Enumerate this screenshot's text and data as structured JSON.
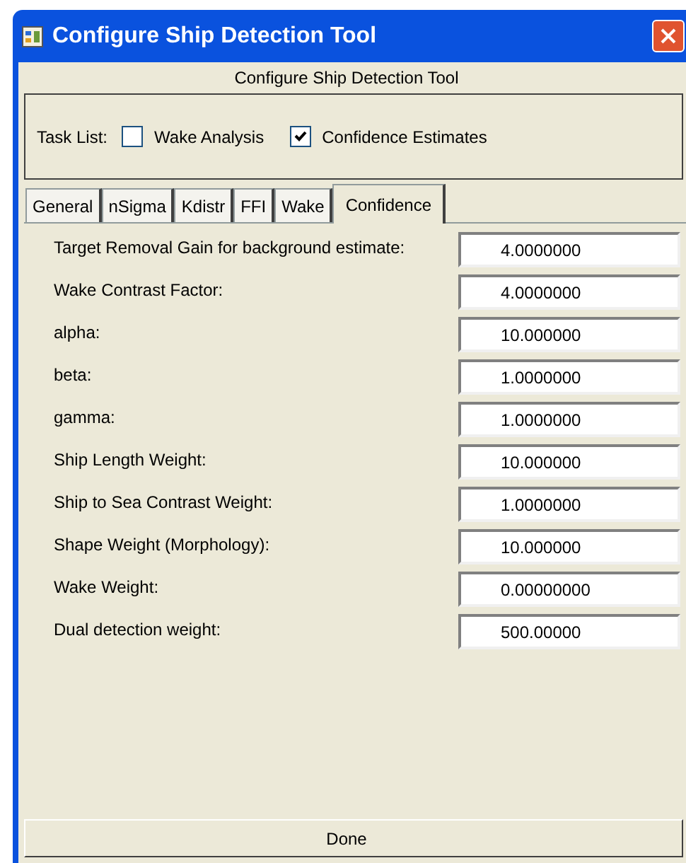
{
  "window": {
    "title": "Configure Ship Detection Tool"
  },
  "header": "Configure Ship Detection Tool",
  "task_list": {
    "label": "Task List:",
    "tasks": [
      {
        "label": "Wake Analysis",
        "checked": false
      },
      {
        "label": "Confidence Estimates",
        "checked": true
      }
    ]
  },
  "tabs": [
    {
      "label": "General",
      "selected": false
    },
    {
      "label": "nSigma",
      "selected": false
    },
    {
      "label": "Kdistr",
      "selected": false
    },
    {
      "label": "FFI",
      "selected": false
    },
    {
      "label": "Wake",
      "selected": false
    },
    {
      "label": "Confidence",
      "selected": true
    }
  ],
  "fields": [
    {
      "label": "Target Removal Gain for background estimate:",
      "value": "4.0000000"
    },
    {
      "label": "Wake Contrast Factor:",
      "value": "4.0000000"
    },
    {
      "label": "alpha:",
      "value": "10.000000"
    },
    {
      "label": "beta:",
      "value": "1.0000000"
    },
    {
      "label": "gamma:",
      "value": "1.0000000"
    },
    {
      "label": "Ship Length Weight:",
      "value": "10.000000"
    },
    {
      "label": "Ship to Sea Contrast Weight:",
      "value": "1.0000000"
    },
    {
      "label": "Shape Weight (Morphology):",
      "value": "10.000000"
    },
    {
      "label": "Wake Weight:",
      "value": "0.00000000"
    },
    {
      "label": "Dual detection weight:",
      "value": "500.00000"
    }
  ],
  "done_button": "Done"
}
